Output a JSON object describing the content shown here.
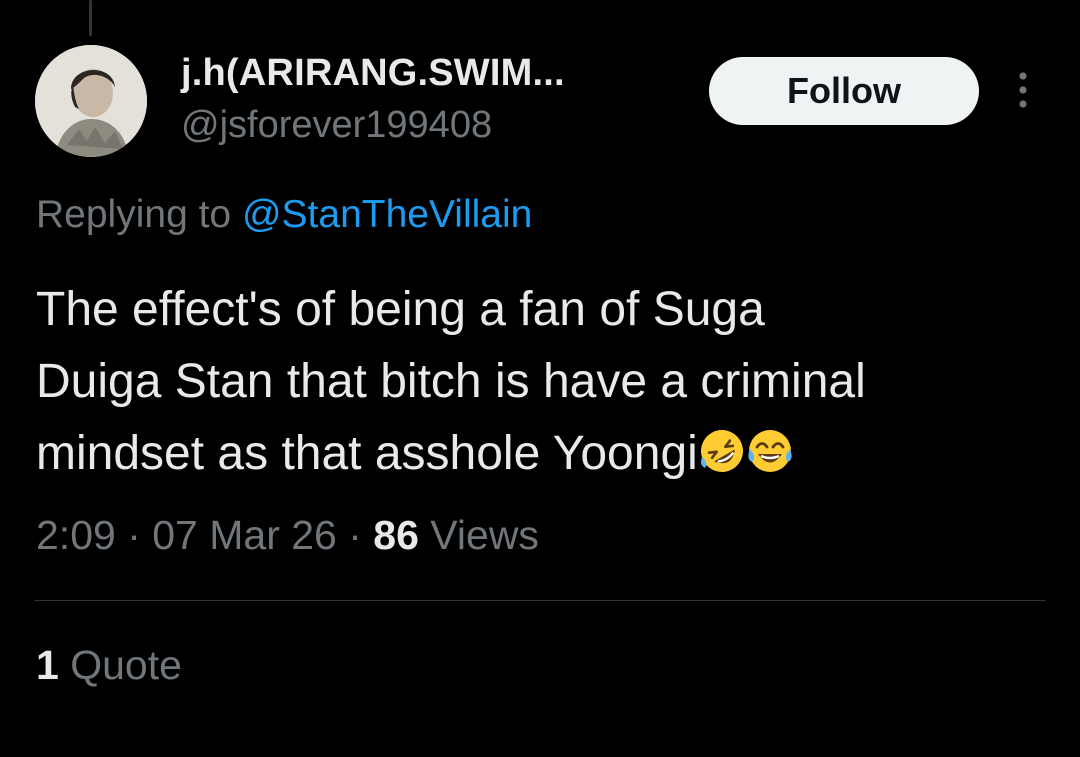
{
  "tweet": {
    "author": {
      "display_name": "j.h(ARIRANG.SWIM...",
      "handle": "@jsforever199408"
    },
    "follow_label": "Follow",
    "replying_prefix": "Replying to ",
    "replying_to": "@StanTheVillain",
    "text_lines": [
      "The effect's of being a fan of Suga",
      "Duiga Stan that bitch is have a criminal",
      "mindset as that asshole Yoongi"
    ],
    "emojis": [
      "rolling-on-floor-laughing-emoji",
      "tears-of-joy-emoji"
    ],
    "time": "2:09",
    "separator": " · ",
    "date": "07 Mar 26",
    "views_count": "86",
    "views_label": " Views",
    "quote_count": "1",
    "quote_label": " Quote"
  },
  "icons": {
    "more": "more-vertical-icon",
    "avatar": "avatar-photo"
  },
  "colors": {
    "background": "#000000",
    "primary_text": "#e7e9ea",
    "secondary_text": "#71767b",
    "link": "#1d9bf0",
    "follow_button_bg": "#eff3f4"
  }
}
